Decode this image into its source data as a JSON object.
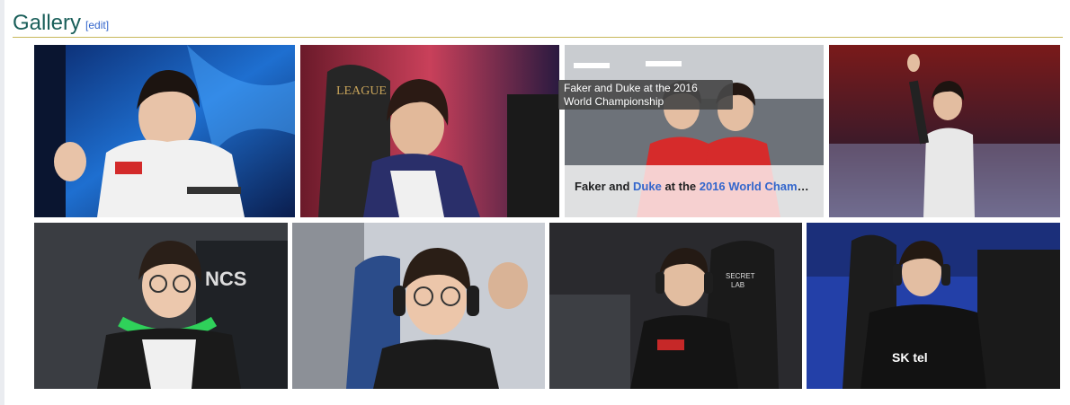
{
  "section": {
    "title": "Gallery",
    "edit_open": "[",
    "edit_label": "edit",
    "edit_close": "]"
  },
  "gallery": {
    "images": [
      {
        "subject": "thumbs-up in jersey"
      },
      {
        "subject": "seated at monitor"
      },
      {
        "subject": "Faker and Duke fists raised"
      },
      {
        "subject": "waving on stage"
      },
      {
        "subject": "green headphones"
      },
      {
        "subject": "blue chair headset"
      },
      {
        "subject": "SECRETLAB chair"
      },
      {
        "subject": "SK telecom jacket"
      }
    ],
    "caption": {
      "part1": "Faker and ",
      "link1": "Duke",
      "part2": " at the ",
      "link2": "2016 World Champions..."
    },
    "tooltip": "Faker and Duke at the 2016 World Championship"
  }
}
